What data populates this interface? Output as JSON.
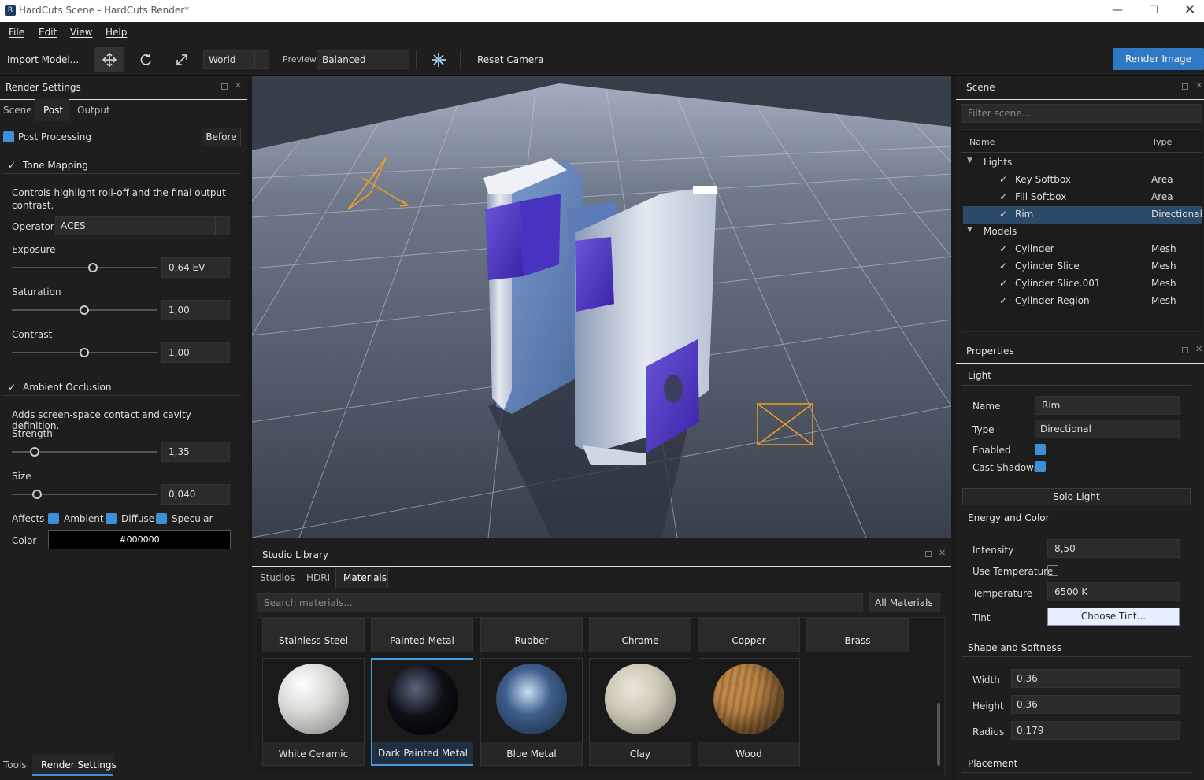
{
  "window": {
    "title": "HardCuts Scene - HardCuts Render*",
    "app_icon": "R",
    "controls": [
      "minimize-icon",
      "maximize-icon",
      "close-icon"
    ]
  },
  "menu": [
    "File",
    "Edit",
    "View",
    "Help"
  ],
  "toolbar": {
    "import_label": "Import Model...",
    "space_value": "World",
    "preview_label": "Preview",
    "preview_value": "Balanced",
    "reset_camera_label": "Reset Camera",
    "render_image_label": "Render Image",
    "icons": [
      "move-icon",
      "rotate-icon",
      "scale-icon",
      "light-burst-icon"
    ]
  },
  "render_settings": {
    "title": "Render Settings",
    "tabs": [
      "Scene",
      "Post",
      "Output"
    ],
    "active_tab": "Post",
    "post_processing_label": "Post Processing",
    "before_label": "Before",
    "tone_mapping": {
      "heading": "Tone Mapping",
      "description": "Controls highlight roll-off and the final output contrast.",
      "operator_label": "Operator",
      "operator_value": "ACES",
      "exposure_label": "Exposure",
      "exposure_value": "0,64 EV",
      "saturation_label": "Saturation",
      "saturation_value": "1,00",
      "contrast_label": "Contrast",
      "contrast_value": "1,00"
    },
    "ambient_occlusion": {
      "heading": "Ambient Occlusion",
      "description": "Adds screen-space contact and cavity definition.",
      "strength_label": "Strength",
      "strength_value": "1,35",
      "size_label": "Size",
      "size_value": "0,040",
      "affects_label": "Affects",
      "affects": [
        "Ambient",
        "Diffuse",
        "Specular"
      ],
      "color_label": "Color",
      "color_value": "#000000"
    }
  },
  "bottom_tabs": [
    "Tools",
    "Render Settings"
  ],
  "studio_library": {
    "title": "Studio Library",
    "tabs": [
      "Studios",
      "HDRI",
      "Materials"
    ],
    "active_tab": "Materials",
    "search_placeholder": "Search materials...",
    "filter_value": "All Materials",
    "row1": [
      "Stainless Steel",
      "Painted Metal",
      "Rubber",
      "Chrome",
      "Copper",
      "Brass"
    ],
    "row2": [
      {
        "name": "White Ceramic",
        "color": "#d9d9d6"
      },
      {
        "name": "Dark Painted Metal",
        "color": "#0d0f16"
      },
      {
        "name": "Blue Metal",
        "color": "#3e5e8c"
      },
      {
        "name": "Clay",
        "color": "#cfc9b9"
      },
      {
        "name": "Wood",
        "color": "#c08a4a"
      }
    ],
    "selected": "Dark Painted Metal"
  },
  "scene": {
    "title": "Scene",
    "filter_placeholder": "Filter scene...",
    "col_name": "Name",
    "col_type": "Type",
    "groups": [
      {
        "name": "Lights",
        "items": [
          {
            "name": "Key Softbox",
            "type": "Area"
          },
          {
            "name": "Fill Softbox",
            "type": "Area"
          },
          {
            "name": "Rim",
            "type": "Directional"
          }
        ]
      },
      {
        "name": "Models",
        "items": [
          {
            "name": "Cylinder",
            "type": "Mesh"
          },
          {
            "name": "Cylinder Slice",
            "type": "Mesh"
          },
          {
            "name": "Cylinder Slice.001",
            "type": "Mesh"
          },
          {
            "name": "Cylinder Region",
            "type": "Mesh"
          }
        ]
      }
    ],
    "selected": "Rim"
  },
  "properties": {
    "title": "Properties",
    "light_heading": "Light",
    "name_label": "Name",
    "name_value": "Rim",
    "type_label": "Type",
    "type_value": "Directional",
    "enabled_label": "Enabled",
    "cast_shadows_label": "Cast Shadows",
    "solo_light_label": "Solo Light",
    "energy_heading": "Energy and Color",
    "intensity_label": "Intensity",
    "intensity_value": "8,50",
    "use_temperature_label": "Use Temperature",
    "temperature_label": "Temperature",
    "temperature_value": "6500 K",
    "tint_label": "Tint",
    "choose_tint_label": "Choose Tint...",
    "shape_heading": "Shape and Softness",
    "width_label": "Width",
    "width_value": "0,36",
    "height_label": "Height",
    "height_value": "0,36",
    "radius_label": "Radius",
    "radius_value": "0,179",
    "placement_heading": "Placement"
  },
  "colors": {
    "accent": "#3d8fd6",
    "render_button": "#2f79c4",
    "selection": "#2b4a6a",
    "light_gizmo": "#f0a020"
  }
}
